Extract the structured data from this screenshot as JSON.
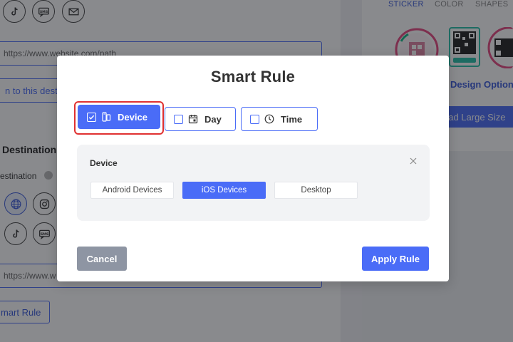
{
  "background": {
    "url_input": {
      "value": "https://www.website.com/path"
    },
    "link_field": {
      "text": "n to this dest"
    },
    "section_heading": "Destination",
    "toggle_label": "estination",
    "url_input_2": {
      "value": "https://www.w"
    },
    "smart_rule_button": "mart Rule",
    "social_icons_top": [
      "tiktok-icon",
      "sms-icon",
      "mail-icon"
    ],
    "social_icons_mid": [
      "globe-icon",
      "instagram-icon"
    ],
    "social_icons_low": [
      "tiktok-icon",
      "sms-icon"
    ],
    "right_tabs": {
      "sticker": "STICKER",
      "color": "COLOR",
      "shapes": "SHAPES"
    },
    "design_options": "Design Options",
    "download_button": "oad Large Size"
  },
  "modal": {
    "title": "Smart Rule",
    "rule_tabs": [
      {
        "label": "Device",
        "icon": "device-icon",
        "checked": true,
        "selected": true
      },
      {
        "label": "Day",
        "icon": "calendar-icon",
        "checked": false,
        "selected": false
      },
      {
        "label": "Time",
        "icon": "clock-icon",
        "checked": false,
        "selected": false
      }
    ],
    "device_panel": {
      "title": "Device",
      "options": [
        {
          "label": "Android Devices",
          "selected": false
        },
        {
          "label": "iOS Devices",
          "selected": true
        },
        {
          "label": "Desktop",
          "selected": false
        }
      ]
    },
    "cancel_label": "Cancel",
    "apply_label": "Apply Rule"
  },
  "colors": {
    "accent": "#4a6cf7",
    "cancel": "#8e95a3",
    "focus_ring": "#e03131",
    "overlay": "rgba(20,22,28,0.5)"
  }
}
